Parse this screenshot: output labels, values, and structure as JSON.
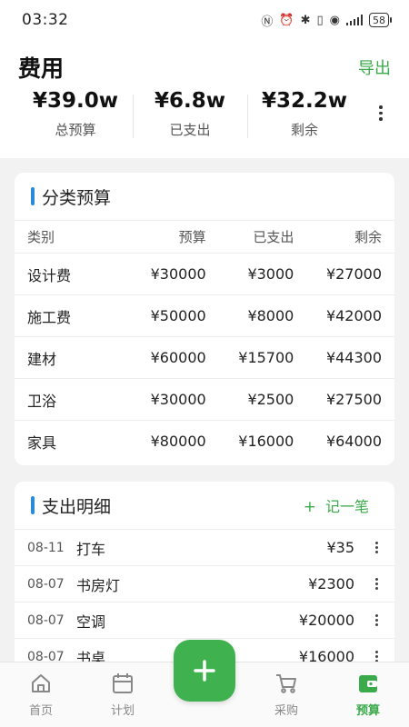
{
  "status_bar": {
    "time": "03:32",
    "battery": "58"
  },
  "header": {
    "title": "费用",
    "export_label": "导出",
    "summary": [
      {
        "value": "¥39.0w",
        "label": "总预算"
      },
      {
        "value": "¥6.8w",
        "label": "已支出"
      },
      {
        "value": "¥32.2w",
        "label": "剩余"
      }
    ]
  },
  "budget": {
    "title": "分类预算",
    "columns": [
      "类别",
      "预算",
      "已支出",
      "剩余"
    ],
    "rows": [
      [
        "设计费",
        "¥30000",
        "¥3000",
        "¥27000"
      ],
      [
        "施工费",
        "¥50000",
        "¥8000",
        "¥42000"
      ],
      [
        "建材",
        "¥60000",
        "¥15700",
        "¥44300"
      ],
      [
        "卫浴",
        "¥30000",
        "¥2500",
        "¥27500"
      ],
      [
        "家具",
        "¥80000",
        "¥16000",
        "¥64000"
      ]
    ]
  },
  "expenses": {
    "title": "支出明细",
    "add_icon": "+",
    "add_label": "记一笔",
    "items": [
      {
        "date": "08-11",
        "name": "打车",
        "amount": "¥35"
      },
      {
        "date": "08-07",
        "name": "书房灯",
        "amount": "¥2300"
      },
      {
        "date": "08-07",
        "name": "空调",
        "amount": "¥20000"
      },
      {
        "date": "08-07",
        "name": "书桌",
        "amount": "¥16000"
      }
    ]
  },
  "nav": {
    "items": [
      {
        "label": "首页",
        "icon": "home-icon"
      },
      {
        "label": "计划",
        "icon": "calendar-icon"
      },
      {
        "label": "采购",
        "icon": "cart-icon"
      },
      {
        "label": "预算",
        "icon": "wallet-icon"
      }
    ],
    "active": "预算"
  },
  "colors": {
    "accent": "#3aaa4a",
    "title_bar": "#2a8bd6"
  }
}
